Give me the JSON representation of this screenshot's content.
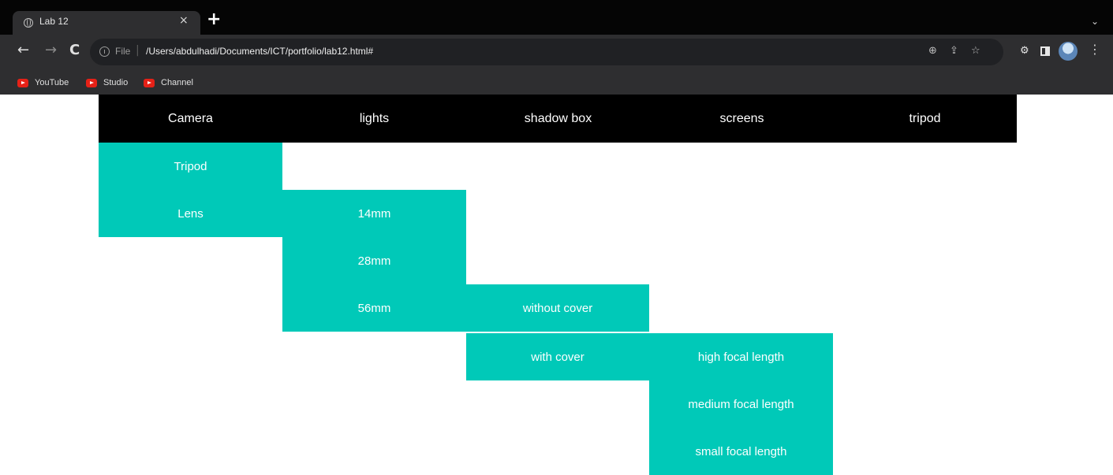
{
  "browser": {
    "tab_title": "Lab 12",
    "tab_close": "×",
    "new_tab": "+",
    "tab_menu": "⌄",
    "nav_back": "←",
    "nav_forward": "→",
    "nav_reload": "C",
    "file_label": "File",
    "url": "/Users/abdulhadi/Documents/ICT/portfolio/lab12.html#",
    "bookmarks": [
      {
        "label": "YouTube"
      },
      {
        "label": "Studio"
      },
      {
        "label": "Channel"
      }
    ]
  },
  "nav": {
    "items": [
      {
        "label": "Camera"
      },
      {
        "label": "lights"
      },
      {
        "label": "shadow box"
      },
      {
        "label": "screens"
      },
      {
        "label": "tripod"
      }
    ]
  },
  "dropdowns": {
    "camera": [
      "Tripod",
      "Lens"
    ],
    "lens": [
      "14mm",
      "28mm",
      "56mm"
    ],
    "mm56": [
      "without cover",
      "with cover"
    ],
    "with_cover": [
      "high focal length",
      "medium focal length",
      "small focal length"
    ]
  },
  "colors": {
    "menu_bg": "#000000",
    "dropdown_bg": "#00c9b8",
    "text": "#ffffff"
  }
}
